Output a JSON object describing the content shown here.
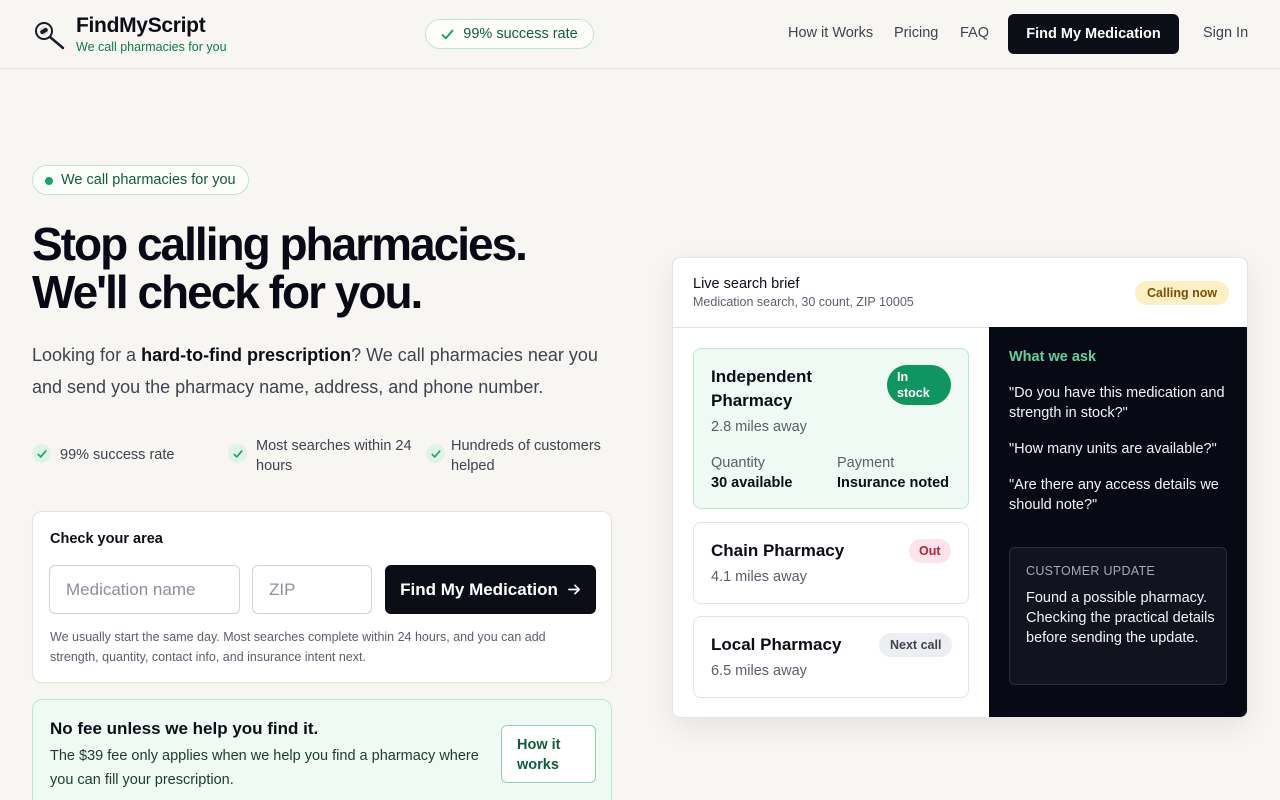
{
  "brand": {
    "name": "FindMyScript",
    "tagline": "We call pharmacies for you"
  },
  "header": {
    "rate_pill": "99% success rate",
    "nav": [
      "How it Works",
      "Pricing",
      "FAQ"
    ],
    "cta": "Find My Medication",
    "sign_in": "Sign In"
  },
  "hero": {
    "eyebrow": "We call pharmacies for you",
    "headline_line1": "Stop calling pharmacies.",
    "headline_line2": "We'll check for you.",
    "lede_before": "Looking for a ",
    "lede_bold": "hard-to-find prescription",
    "lede_after": "? We call pharmacies near you and send you the pharmacy name, address, and phone number.",
    "features": [
      "99% success rate",
      "Most searches within 24 hours",
      "Hundreds of customers helped"
    ]
  },
  "search": {
    "title": "Check your area",
    "medication_placeholder": "Medication name",
    "zip_placeholder": "ZIP",
    "button": "Find My Medication",
    "note": "We usually start the same day. Most searches complete within 24 hours, and you can add strength, quantity, contact info, and insurance intent next."
  },
  "fee": {
    "title": "No fee unless we help you find it.",
    "text": "The $39 fee only applies when we help you find a pharmacy where you can fill your prescription.",
    "button": "How it works"
  },
  "panel": {
    "title": "Live search brief",
    "subtitle": "Medication search, 30 count, ZIP 10005",
    "status": "Calling now",
    "pharmacies": [
      {
        "name": "Independent Pharmacy",
        "distance": "2.8 miles away",
        "badge": "In stock",
        "quantity_label": "Quantity",
        "quantity_value": "30 available",
        "payment_label": "Payment",
        "payment_value": "Insurance noted"
      },
      {
        "name": "Chain Pharmacy",
        "distance": "4.1 miles away",
        "badge": "Out"
      },
      {
        "name": "Local Pharmacy",
        "distance": "6.5 miles away",
        "badge": "Next call"
      }
    ],
    "ask": {
      "title": "What we ask",
      "questions": [
        "\"Do you have this medication and strength in stock?\"",
        "\"How many units are available?\"",
        "\"Are there any access details we should note?\""
      ],
      "update_label": "CUSTOMER UPDATE",
      "update_text": "Found a possible pharmacy. Checking the practical details before sending the update."
    }
  },
  "colors": {
    "accent_green": "#0f9560",
    "dark": "#0b0d17",
    "background": "#f7f6f2",
    "calling_bg": "#fdf0c4"
  },
  "icons": {
    "logo": "magnifier-pill-icon",
    "check": "check-icon",
    "arrow": "arrow-right-icon"
  }
}
